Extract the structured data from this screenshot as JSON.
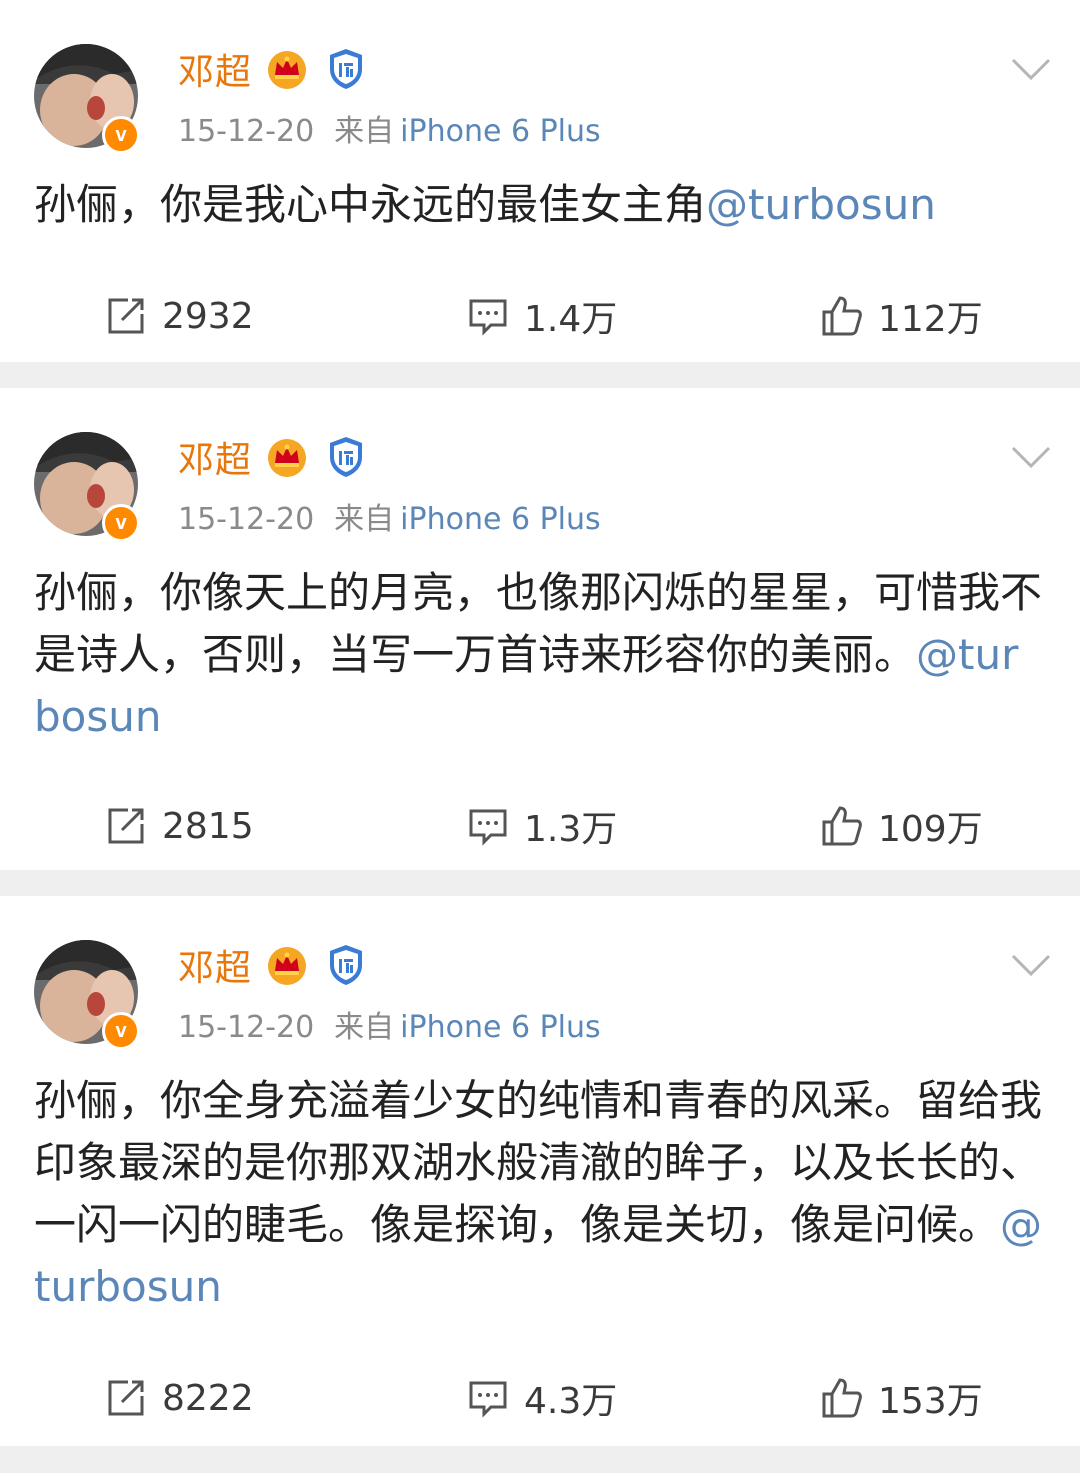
{
  "colors": {
    "name": "#e8760a",
    "link": "#5b86b8",
    "meta": "#8a8a8a",
    "badge": "#ff8a00",
    "separator": "#efefef"
  },
  "posts": [
    {
      "user": "邓超",
      "date": "15-12-20",
      "from_label": "来自",
      "device": "iPhone 6 Plus",
      "text": "孙俪，你是我心中永远的最佳女主角",
      "mention": "@turbosun",
      "reposts": "2932",
      "comments": "1.4万",
      "likes": "112万",
      "icons": [
        "verified-icon",
        "crown-icon",
        "shield-icon",
        "chevron-down-icon",
        "repost-icon",
        "comment-icon",
        "like-icon"
      ]
    },
    {
      "user": "邓超",
      "date": "15-12-20",
      "from_label": "来自",
      "device": "iPhone 6 Plus",
      "text": "孙俪，你像天上的月亮，也像那闪烁的星星，可惜我不是诗人，否则，当写一万首诗来形容你的美丽。",
      "mention": "@turbosun",
      "reposts": "2815",
      "comments": "1.3万",
      "likes": "109万",
      "icons": [
        "verified-icon",
        "crown-icon",
        "shield-icon",
        "chevron-down-icon",
        "repost-icon",
        "comment-icon",
        "like-icon"
      ]
    },
    {
      "user": "邓超",
      "date": "15-12-20",
      "from_label": "来自",
      "device": "iPhone 6 Plus",
      "text": "孙俪，你全身充溢着少女的纯情和青春的风采。留给我印象最深的是你那双湖水般清澈的眸子，以及长长的、一闪一闪的睫毛。像是探询，像是关切，像是问候。",
      "mention": "@turbosun",
      "reposts": "8222",
      "comments": "4.3万",
      "likes": "153万",
      "icons": [
        "verified-icon",
        "crown-icon",
        "shield-icon",
        "chevron-down-icon",
        "repost-icon",
        "comment-icon",
        "like-icon"
      ]
    }
  ]
}
